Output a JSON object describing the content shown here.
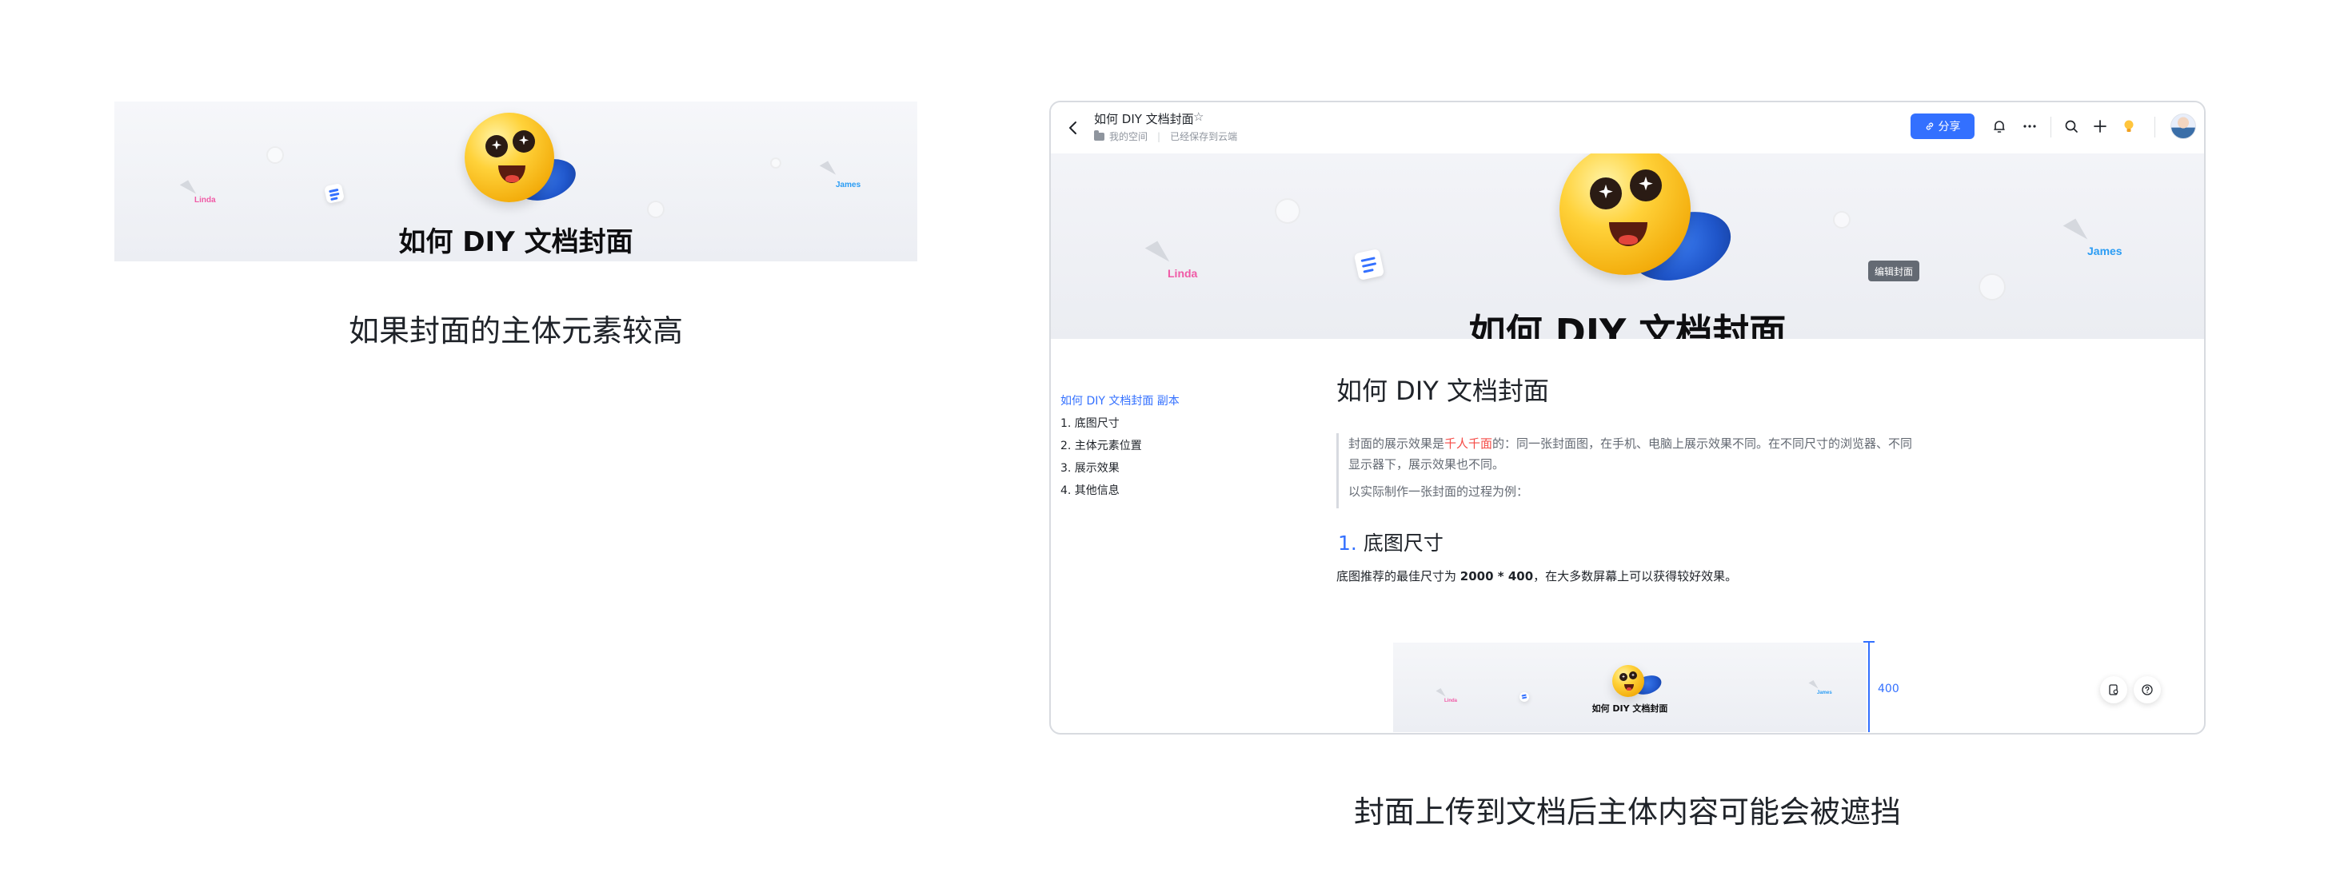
{
  "left_panel": {
    "banner_title": "如何 DIY 文档封面",
    "cursor_names": [
      "Linda",
      "James"
    ],
    "caption": "如果封面的主体元素较高"
  },
  "right_panel": {
    "window": {
      "doc_title": "如何 DIY 文档封面",
      "breadcrumb": "我的空间",
      "save_status": "已经保存到云端",
      "share_label": "分享",
      "icons": [
        "back-icon",
        "star-icon",
        "folder-icon",
        "link-icon",
        "bell-icon",
        "more-icon",
        "search-icon",
        "plus-icon",
        "lightbulb-icon",
        "avatar"
      ]
    },
    "cover": {
      "title": "如何 DIY 文档封面",
      "cursor_names": [
        "Linda",
        "James"
      ],
      "edit_cover_label": "编辑封面"
    },
    "toc": {
      "items": [
        "如何 DIY 文档封面 副本",
        "1. 底图尺寸",
        "2. 主体元素位置",
        "3. 展示效果",
        "4. 其他信息"
      ]
    },
    "doc": {
      "h1": "如何 DIY 文档封面",
      "quote_before": "封面的展示效果是",
      "quote_highlight": "千人千面",
      "quote_after": "的：同一张封面图，在手机、电脑上展示效果不同。在不同尺寸的浏览器、不同显示器下，展示效果也不同。",
      "quote_line2": "以实际制作一张封面的过程为例：",
      "h2_number": "1.",
      "h2_text": "底图尺寸",
      "para_before": "底图推荐的最佳尺寸为 ",
      "para_bold": "2000 * 400",
      "para_after": "，在大多数屏幕上可以获得较好效果。",
      "mini_banner_title": "如何 DIY 文档封面",
      "mini_cursor_names": [
        "Linda",
        "James"
      ],
      "measure_label": "400"
    },
    "caption": "封面上传到文档后主体内容可能会被遮挡"
  },
  "colors": {
    "accent": "#3370ff",
    "highlight": "#f54a45",
    "cursor_linda": "#f05aa6",
    "cursor_james": "#2a9cf4"
  }
}
